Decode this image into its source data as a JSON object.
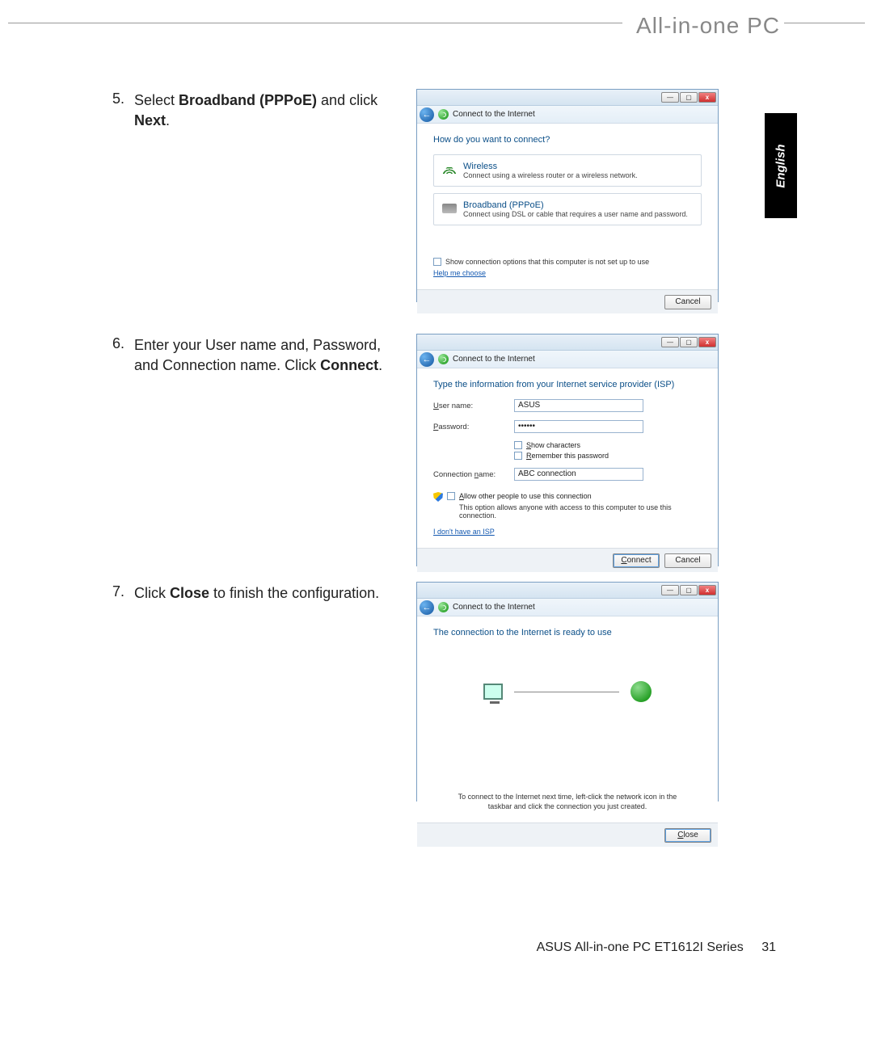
{
  "header": {
    "title": "All-in-one PC"
  },
  "lang_tab": "English",
  "steps": {
    "s5": {
      "num": "5.",
      "pre": "Select ",
      "bold1": "Broadband (PPPoE)",
      "mid": " and click ",
      "bold2": "Next",
      "post": "."
    },
    "s6": {
      "num": "6.",
      "pre": "Enter your User name and, Password, and Connection name. Click ",
      "bold1": "Connect",
      "post": "."
    },
    "s7": {
      "num": "7.",
      "pre": "Click ",
      "bold1": "Close",
      "post": " to finish the configuration."
    }
  },
  "dialog_common": {
    "back": "←",
    "title_icon": "connect-icon",
    "title_text": "Connect to the Internet",
    "min": "—",
    "max": "▢",
    "close": "x"
  },
  "dialog1": {
    "prompt": "How do you want to connect?",
    "opt1_title": "Wireless",
    "opt1_desc": "Connect using a wireless router or a wireless network.",
    "opt2_title": "Broadband (PPPoE)",
    "opt2_desc": "Connect using DSL or cable that requires a user name and password.",
    "show_options": "Show connection options that this computer is not set up to use",
    "help_link": "Help me choose",
    "cancel": "Cancel"
  },
  "dialog2": {
    "prompt": "Type the information from your Internet service provider (ISP)",
    "username_label_u": "U",
    "username_label": "ser name:",
    "username_value": "ASUS",
    "password_label_u": "P",
    "password_label": "assword:",
    "password_value": "••••••",
    "show_chars_u": "S",
    "show_chars": "how characters",
    "remember_u": "R",
    "remember": "emember this password",
    "connname_label": "Connection ",
    "connname_label_u": "n",
    "connname_label_post": "ame:",
    "connname_value": "ABC connection",
    "allow_u": "A",
    "allow": "llow other people to use this connection",
    "allow_desc": "This option allows anyone with access to this computer to use this connection.",
    "no_isp": "I don't have an ISP",
    "connect_btn_u": "C",
    "connect_btn": "onnect",
    "cancel": "Cancel"
  },
  "dialog3": {
    "prompt": "The connection to the Internet is ready to use",
    "info": "To connect to the Internet next time, left-click the network icon in the taskbar and click the connection you just created.",
    "close_btn_u": "C",
    "close_btn": "lose"
  },
  "footer": {
    "text": "ASUS All-in-one PC  ET1612I Series",
    "page": "31"
  }
}
